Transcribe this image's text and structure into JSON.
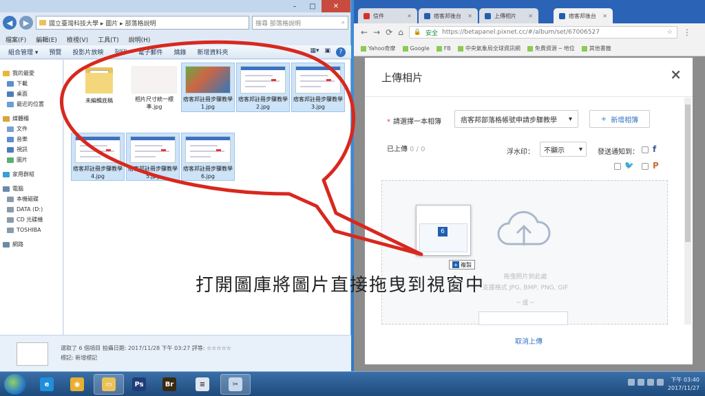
{
  "explorer": {
    "address": "國立臺灣科技大學 ▸ 圖片 ▸ 部落格說明",
    "search_placeholder": "搜尋 部落格說明",
    "menu": [
      "檔案(F)",
      "編輯(E)",
      "檢視(V)",
      "工具(T)",
      "說明(H)"
    ],
    "toolbar": [
      "組合管理 ▾",
      "預覽",
      "投影片放映",
      "列印",
      "電子郵件",
      "燒錄",
      "新增資料夾"
    ],
    "nav": [
      {
        "label": "我的最愛",
        "head": true,
        "color": "#e8b63a"
      },
      {
        "label": "下載",
        "head": false,
        "color": "#5a8fd0"
      },
      {
        "label": "桌面",
        "head": false,
        "color": "#4a7fbf"
      },
      {
        "label": "最近的位置",
        "head": false,
        "color": "#6a9fd8"
      },
      {
        "label": "媒體櫃",
        "head": true,
        "color": "#d9a43a"
      },
      {
        "label": "文件",
        "head": false,
        "color": "#7aa0d0"
      },
      {
        "label": "音樂",
        "head": false,
        "color": "#5a8fd0"
      },
      {
        "label": "視訊",
        "head": false,
        "color": "#4a7fbf"
      },
      {
        "label": "圖片",
        "head": false,
        "color": "#5ab070"
      },
      {
        "label": "家用群組",
        "head": true,
        "color": "#3aa0d0"
      },
      {
        "label": "電腦",
        "head": true,
        "color": "#6a8aa8"
      },
      {
        "label": "本機磁碟",
        "head": false,
        "color": "#8a9aaa"
      },
      {
        "label": "DATA (D:)",
        "head": false,
        "color": "#8a9aaa"
      },
      {
        "label": "CD 光碟機",
        "head": false,
        "color": "#8a9aaa"
      },
      {
        "label": "TOSHIBA",
        "head": false,
        "color": "#8a9aaa"
      },
      {
        "label": "網路",
        "head": true,
        "color": "#6a8aa8"
      }
    ],
    "files": [
      {
        "name": "未編輯底稿",
        "kind": "folder",
        "selected": false
      },
      {
        "name": "相片尺寸統一標準.jpg",
        "kind": "blank",
        "selected": false
      },
      {
        "name": "痞客邦註冊步驟教學1.jpg",
        "kind": "photo",
        "selected": true
      },
      {
        "name": "痞客邦註冊步驟教學2.jpg",
        "kind": "screen",
        "selected": true
      },
      {
        "name": "痞客邦註冊步驟教學3.jpg",
        "kind": "screen",
        "selected": true
      },
      {
        "name": "痞客邦註冊步驟教學4.jpg",
        "kind": "screen",
        "selected": true
      },
      {
        "name": "痞客邦註冊步驟教學5.jpg",
        "kind": "screen",
        "selected": true
      },
      {
        "name": "痞客邦註冊步驟教學6.jpg",
        "kind": "screen",
        "selected": true
      }
    ],
    "status_line1": "選取了 6 個項目   拍攝日期: 2017/11/28 下午 03:27   評等: ☆☆☆☆☆",
    "status_line2": "標記: 新增標記"
  },
  "browser": {
    "tabs": [
      {
        "label": "信件",
        "color": "#d93025",
        "active": false
      },
      {
        "label": "痞客邦後台",
        "color": "#1f5fae",
        "active": false
      },
      {
        "label": "上傳相片",
        "color": "#1f5fae",
        "active": false
      },
      {
        "label": "痞客邦後台",
        "color": "#1f5fae",
        "active": true
      }
    ],
    "secure_label": "安全",
    "url": "https://betapanel.pixnet.cc/#/album/set/67006527",
    "bookmarks": [
      "Yahoo奇摩",
      "Google",
      "FB",
      "中央氣象局全球資訊網",
      "免費資源 ─ 地位",
      "其他書籤"
    ]
  },
  "modal": {
    "title": "上傳相片",
    "close": "×",
    "choose_label": "請選擇一本相簿",
    "album_value": "痞客邦部落格帳號申請步驟教學",
    "new_album": "新增相簿",
    "uploaded_label": "已上傳",
    "uploaded_count": "0 / 0",
    "watermark_label": "浮水印：",
    "watermark_value": "不顯示",
    "notify_label": "發送通知到：",
    "drop_line1": "拖曳照片到此處",
    "drop_line2": "支援格式 JPG, BMP, PNG, GIF",
    "drop_or": "─ 或 ─",
    "cancel": "取消上傳"
  },
  "drag": {
    "badge": "6",
    "copy_label": "複製"
  },
  "annotation": {
    "text": "打開圖庫將圖片直接拖曳到視窗中",
    "ellipse_color": "#d8281f"
  },
  "taskbar": {
    "apps": [
      {
        "name": "ie",
        "color": "#1e8fdc",
        "glyph": "e",
        "active": false
      },
      {
        "name": "chrome",
        "color": "#e8b030",
        "glyph": "◉",
        "active": false
      },
      {
        "name": "explorer",
        "color": "#e9c25a",
        "glyph": "▭",
        "active": true
      },
      {
        "name": "photoshop",
        "color": "#1f3c78",
        "glyph": "Ps",
        "active": false
      },
      {
        "name": "bridge",
        "color": "#3a2a10",
        "glyph": "Br",
        "active": false
      },
      {
        "name": "notepad",
        "color": "#dfe6ee",
        "glyph": "≡",
        "active": false
      },
      {
        "name": "snipping",
        "color": "#c8d8ec",
        "glyph": "✂",
        "active": true
      }
    ],
    "clock_time": "下午 03:40",
    "clock_date": "2017/11/27"
  }
}
